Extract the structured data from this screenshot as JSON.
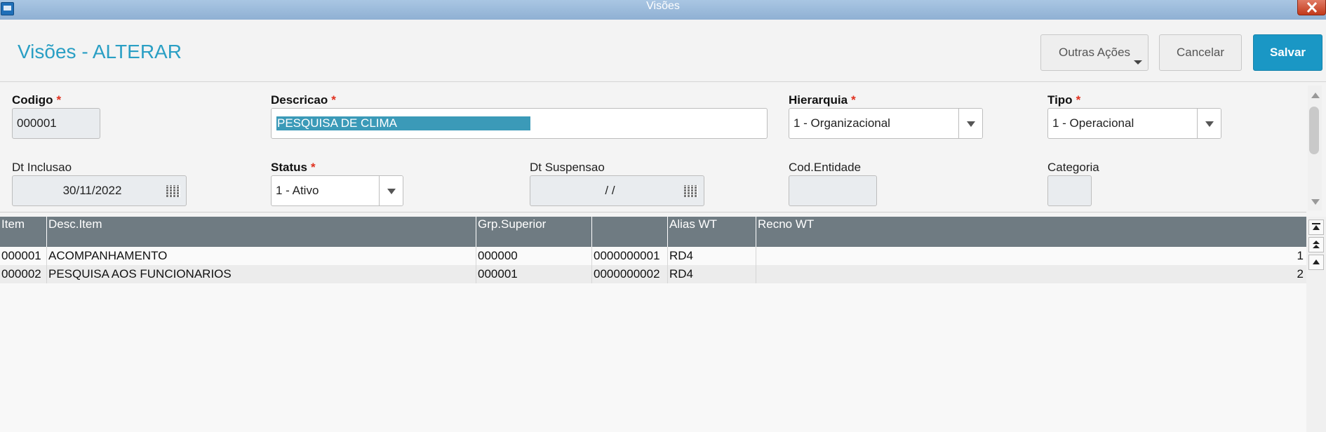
{
  "window": {
    "title": "Visões",
    "close_icon": "close-icon",
    "app_icon": "window-app-icon"
  },
  "header": {
    "title": "Visões - ALTERAR",
    "buttons": {
      "outras": "Outras Ações",
      "cancelar": "Cancelar",
      "salvar": "Salvar"
    },
    "colors": {
      "title": "#2a9fc4",
      "salvar_bg": "#1a97c5"
    }
  },
  "form": {
    "codigo": {
      "label": "Codigo",
      "required_mark": "*",
      "value": "000001"
    },
    "descricao": {
      "label": "Descricao",
      "required_mark": "*",
      "value": "PESQUISA DE CLIMA"
    },
    "hierarquia": {
      "label": "Hierarquia",
      "required_mark": "*",
      "value": "1 - Organizacional"
    },
    "tipo": {
      "label": "Tipo",
      "required_mark": "*",
      "value": "1 - Operacional"
    },
    "dt_inclusao": {
      "label": "Dt Inclusao",
      "value": "30/11/2022"
    },
    "status": {
      "label": "Status",
      "required_mark": "*",
      "value": "1 - Ativo"
    },
    "dt_suspensao": {
      "label": "Dt Suspensao",
      "value": "/ /"
    },
    "cod_entidade": {
      "label": "Cod.Entidade",
      "value": ""
    },
    "categoria": {
      "label": "Categoria",
      "value": ""
    }
  },
  "grid": {
    "columns": [
      "Item",
      "Desc.Item",
      "Grp.Superior",
      "",
      "Alias WT",
      "Recno WT"
    ],
    "rows": [
      [
        "000001",
        "ACOMPANHAMENTO",
        "000000",
        "0000000001",
        "RD4",
        "1"
      ],
      [
        "000002",
        "PESQUISA AOS FUNCIONARIOS",
        "000001",
        "0000000002",
        "RD4",
        "2"
      ]
    ]
  }
}
